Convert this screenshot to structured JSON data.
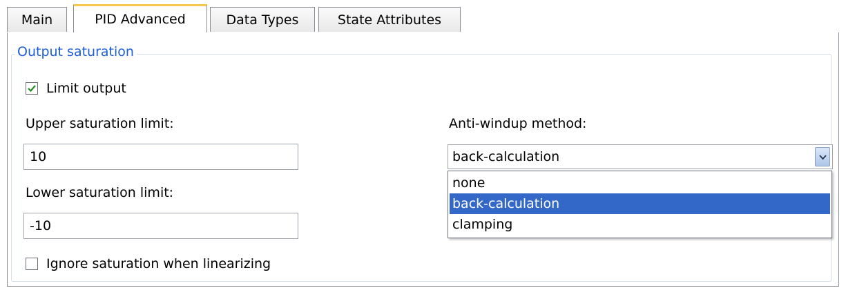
{
  "tabs": [
    {
      "label": "Main"
    },
    {
      "label": "PID Advanced"
    },
    {
      "label": "Data Types"
    },
    {
      "label": "State Attributes"
    }
  ],
  "active_tab": "PID Advanced",
  "group": {
    "title": "Output saturation"
  },
  "limit_output": {
    "label": "Limit output",
    "checked": true
  },
  "upper_limit": {
    "label": "Upper saturation limit:",
    "value": "10"
  },
  "lower_limit": {
    "label": "Lower saturation limit:",
    "value": "-10"
  },
  "anti_windup": {
    "label": "Anti-windup method:",
    "value": "back-calculation",
    "options": [
      "none",
      "back-calculation",
      "clamping"
    ],
    "highlighted": "back-calculation"
  },
  "ignore_saturation": {
    "label": "Ignore saturation when linearizing",
    "checked": false
  },
  "colors": {
    "accent": "#1c5fd6",
    "selection": "#3468c8",
    "active_tab_top": "#f5c84c"
  }
}
